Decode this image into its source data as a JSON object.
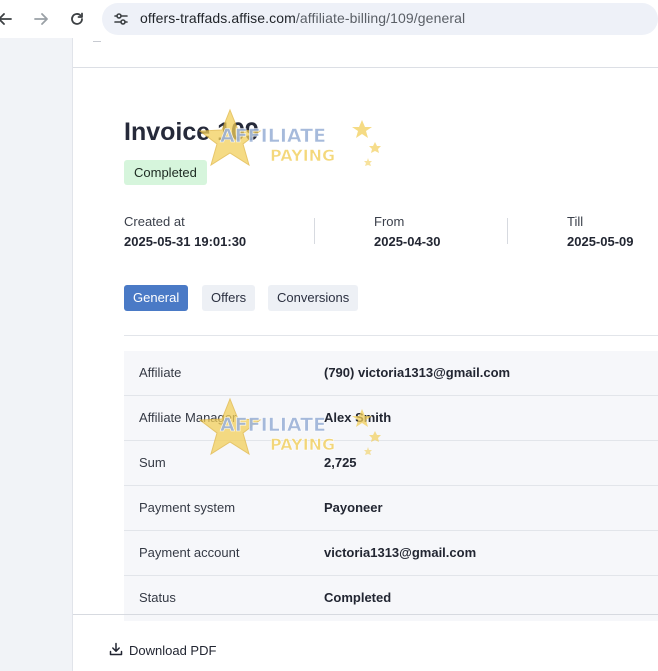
{
  "browser": {
    "url_host": "offers-traffads.affise.com",
    "url_path": "/affiliate-billing/109/general"
  },
  "invoice": {
    "title": "Invoice 109",
    "status_badge": "Completed",
    "meta": [
      {
        "label": "Created at",
        "value": "2025-05-31 19:01:30"
      },
      {
        "label": "From",
        "value": "2025-04-30"
      },
      {
        "label": "Till",
        "value": "2025-05-09"
      }
    ]
  },
  "tabs": [
    {
      "label": "General",
      "active": true
    },
    {
      "label": "Offers",
      "active": false
    },
    {
      "label": "Conversions",
      "active": false
    }
  ],
  "details": [
    {
      "label": "Affiliate",
      "value": "(790) victoria1313@gmail.com"
    },
    {
      "label": "Affiliate Manager",
      "value": "Alex Smith"
    },
    {
      "label": "Sum",
      "value": "2,725"
    },
    {
      "label": "Payment system",
      "value": "Payoneer"
    },
    {
      "label": "Payment account",
      "value": "victoria1313@gmail.com"
    },
    {
      "label": "Status",
      "value": "Completed"
    }
  ],
  "actions": {
    "download_pdf": "Download PDF"
  },
  "watermark": {
    "line1": "AFFILIATE",
    "line2": "PAYING"
  },
  "colors": {
    "accent": "#4a7ac6",
    "badge_bg": "#d6f5dc"
  }
}
